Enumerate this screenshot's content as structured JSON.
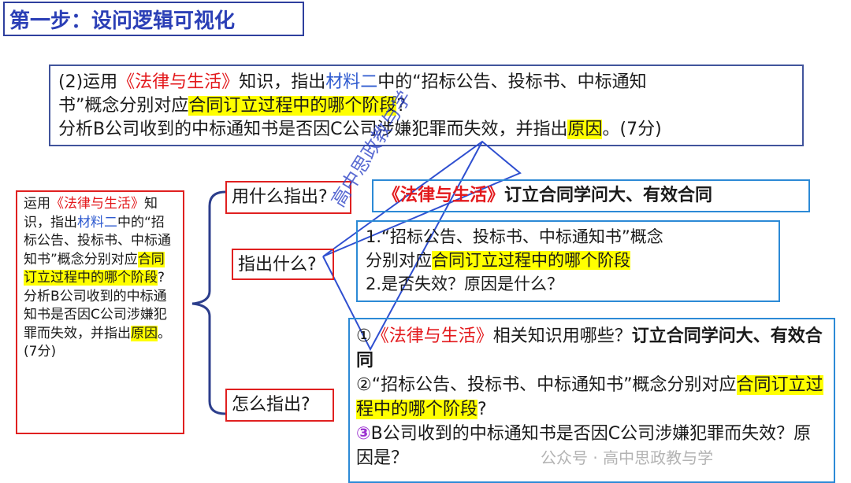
{
  "slide_title": "第一步：设问逻辑可视化",
  "question": {
    "line1_pre": "(2)运用",
    "line1_book": "《法律与生活》",
    "line1_mid": "知识，指出",
    "line1_mat": "材料二",
    "line1_post": "中的“招标公告、投标书、中标通知",
    "line2_pre": "书”概念分别对应",
    "line2_hl": "合同订立过程中的哪个阶段",
    "line2_post": "?",
    "line3_pre": "分析B公司收到的中标通知书是否因C公司涉嫌犯罪而失效，并指出",
    "line3_hl": "原因",
    "line3_post": "。(7分)"
  },
  "left_panel": {
    "p1": "运用",
    "book": "《法律与生活》",
    "p2": "知识，指出",
    "mat": "材料二",
    "p3": "中的“招标公告、投标书、中标通知书”概念分别对应",
    "hl1": "合同订立过程中的哪个阶段",
    "p4": "?",
    "p5": "分析B公司收到的中标通知书是否因C公司涉嫌犯罪而失效，并指出",
    "hl2": "原因",
    "p6": "。(7分)"
  },
  "buttons": {
    "what_use": "用什么指出?",
    "what_point": "指出什么?",
    "how_point": "怎么指出?"
  },
  "answer_use": {
    "book": "《法律与生活》",
    "text": "订立合同学问大、有效合同"
  },
  "answer_what": {
    "l1": "1.“招标公告、投标书、中标通知书”概念",
    "l2_pre": "分别对应",
    "l2_hl": "合同订立过程中的哪个阶段",
    "l3": "2.是否失效？原因是什么？"
  },
  "answer_how": {
    "c1": "①",
    "c1_book": "《法律与生活》",
    "c1_text": "相关知识用哪些？",
    "c1_bold": "订立合同学问大、有效合同",
    "c2": "②",
    "c2_text": "“招标公告、投标书、中标通知书”概念分别对应",
    "c2_hl": "合同订立过程中的哪个阶段",
    "c2_post": "?",
    "c3": "③",
    "c3_text": "B公司收到的中标通知书是否因C公司涉嫌犯罪而失效？原因是？"
  },
  "watermark": "高中思政教与学",
  "watermark_footer": "公众号 · 高中思政教与学"
}
